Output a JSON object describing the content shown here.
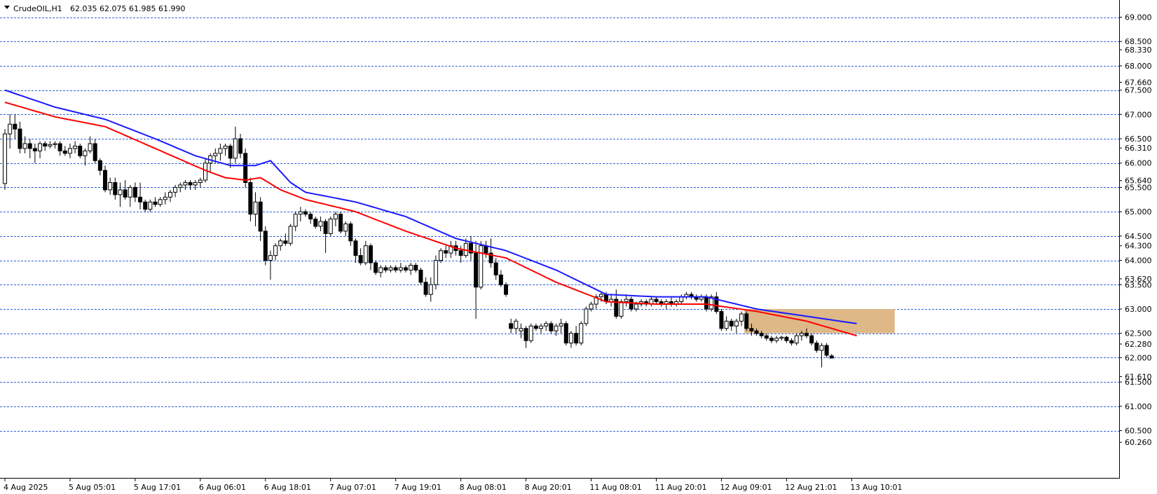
{
  "header": {
    "symbol_label": "CrudeOIL,H1",
    "ohlc_label": "62.035 62.075 61.985 61.990"
  },
  "colors": {
    "background": "#ffffff",
    "grid": "#2d5fd6",
    "candle": "#000000",
    "ma_slow": "#1a1aff",
    "ma_fast": "#ff0000",
    "zone": "#deb887"
  },
  "chart_data": {
    "type": "candlestick",
    "symbol": "CrudeOIL",
    "timeframe": "H1",
    "last_ohlc": {
      "open": 62.035,
      "high": 62.075,
      "low": 61.985,
      "close": 61.99
    },
    "ylim": [
      60.0,
      69.3
    ],
    "grid": true,
    "grid_levels": [
      69.0,
      68.5,
      68.0,
      67.5,
      67.0,
      66.5,
      66.0,
      65.5,
      65.0,
      64.5,
      64.0,
      63.5,
      63.0,
      62.5,
      62.0,
      61.5,
      61.0,
      60.5
    ],
    "y_tick_labels": [
      "69.000",
      "68.500",
      "68.330",
      "68.000",
      "67.660",
      "67.500",
      "67.000",
      "66.500",
      "66.310",
      "66.000",
      "65.640",
      "65.500",
      "65.000",
      "64.500",
      "64.300",
      "64.000",
      "63.620",
      "63.500",
      "63.000",
      "62.500",
      "62.280",
      "62.000",
      "61.610",
      "61.500",
      "61.000",
      "60.500",
      "60.260"
    ],
    "y_tick_values": [
      69.0,
      68.5,
      68.33,
      68.0,
      67.66,
      67.5,
      67.0,
      66.5,
      66.31,
      66.0,
      65.64,
      65.5,
      65.0,
      64.5,
      64.3,
      64.0,
      63.62,
      63.5,
      63.0,
      62.5,
      62.28,
      62.0,
      61.61,
      61.5,
      61.0,
      60.5,
      60.26
    ],
    "x_tick_labels": [
      "4 Aug 2025",
      "5 Aug 05:01",
      "5 Aug 17:01",
      "6 Aug 06:01",
      "6 Aug 18:01",
      "7 Aug 07:01",
      "7 Aug 19:01",
      "8 Aug 08:01",
      "8 Aug 20:01",
      "11 Aug 08:01",
      "11 Aug 20:01",
      "12 Aug 09:01",
      "12 Aug 21:01",
      "13 Aug 10:01"
    ],
    "x_tick_bar_index": [
      0,
      13,
      26,
      39,
      52,
      65,
      78,
      91,
      104,
      117,
      130,
      143,
      156,
      169
    ],
    "zone": {
      "start_bar": 148,
      "end_bar": 178,
      "top": 63.0,
      "bottom": 62.5
    },
    "ma_fast_anchors": [
      [
        0,
        67.25
      ],
      [
        10,
        66.95
      ],
      [
        20,
        66.75
      ],
      [
        30,
        66.3
      ],
      [
        40,
        65.85
      ],
      [
        44,
        65.7
      ],
      [
        48,
        65.65
      ],
      [
        51,
        65.7
      ],
      [
        55,
        65.45
      ],
      [
        60,
        65.25
      ],
      [
        70,
        65.0
      ],
      [
        80,
        64.6
      ],
      [
        90,
        64.25
      ],
      [
        100,
        64.05
      ],
      [
        110,
        63.55
      ],
      [
        120,
        63.15
      ],
      [
        130,
        63.1
      ],
      [
        140,
        63.1
      ],
      [
        150,
        62.95
      ],
      [
        160,
        62.75
      ],
      [
        170,
        62.45
      ]
    ],
    "ma_slow_anchors": [
      [
        0,
        67.5
      ],
      [
        10,
        67.15
      ],
      [
        20,
        66.9
      ],
      [
        30,
        66.5
      ],
      [
        38,
        66.15
      ],
      [
        45,
        65.95
      ],
      [
        50,
        65.95
      ],
      [
        53,
        66.05
      ],
      [
        57,
        65.6
      ],
      [
        60,
        65.4
      ],
      [
        70,
        65.2
      ],
      [
        80,
        64.9
      ],
      [
        90,
        64.45
      ],
      [
        100,
        64.2
      ],
      [
        110,
        63.8
      ],
      [
        120,
        63.3
      ],
      [
        130,
        63.25
      ],
      [
        140,
        63.25
      ],
      [
        150,
        63.0
      ],
      [
        160,
        62.85
      ],
      [
        170,
        62.7
      ]
    ],
    "ohlc": [
      [
        65.58,
        66.7,
        65.45,
        66.6
      ],
      [
        66.6,
        67.0,
        66.3,
        66.8
      ],
      [
        66.8,
        67.0,
        66.5,
        66.7
      ],
      [
        66.7,
        66.85,
        66.2,
        66.3
      ],
      [
        66.3,
        66.55,
        66.2,
        66.4
      ],
      [
        66.4,
        66.5,
        66.1,
        66.3
      ],
      [
        66.3,
        66.4,
        66.0,
        66.25
      ],
      [
        66.25,
        66.45,
        66.1,
        66.4
      ],
      [
        66.4,
        66.45,
        66.25,
        66.35
      ],
      [
        66.35,
        66.45,
        66.3,
        66.38
      ],
      [
        66.38,
        66.45,
        66.3,
        66.4
      ],
      [
        66.4,
        66.45,
        66.15,
        66.25
      ],
      [
        66.25,
        66.35,
        66.15,
        66.2
      ],
      [
        66.2,
        66.4,
        66.1,
        66.3
      ],
      [
        66.3,
        66.45,
        66.2,
        66.35
      ],
      [
        66.35,
        66.4,
        66.1,
        66.15
      ],
      [
        66.15,
        66.3,
        65.95,
        66.25
      ],
      [
        66.25,
        66.55,
        66.2,
        66.4
      ],
      [
        66.4,
        66.5,
        66.0,
        66.05
      ],
      [
        66.05,
        66.1,
        65.75,
        65.85
      ],
      [
        65.85,
        65.95,
        65.4,
        65.45
      ],
      [
        65.45,
        65.7,
        65.35,
        65.6
      ],
      [
        65.6,
        65.7,
        65.25,
        65.35
      ],
      [
        65.35,
        65.6,
        65.1,
        65.45
      ],
      [
        65.45,
        65.65,
        65.25,
        65.3
      ],
      [
        65.3,
        65.55,
        65.1,
        65.5
      ],
      [
        65.5,
        65.6,
        65.2,
        65.3
      ],
      [
        65.3,
        65.6,
        65.05,
        65.2
      ],
      [
        65.2,
        65.25,
        65.0,
        65.05
      ],
      [
        65.05,
        65.25,
        65.0,
        65.2
      ],
      [
        65.2,
        65.3,
        65.1,
        65.15
      ],
      [
        65.15,
        65.3,
        65.1,
        65.25
      ],
      [
        65.25,
        65.4,
        65.15,
        65.3
      ],
      [
        65.3,
        65.45,
        65.2,
        65.4
      ],
      [
        65.4,
        65.55,
        65.3,
        65.5
      ],
      [
        65.5,
        65.6,
        65.4,
        65.55
      ],
      [
        65.55,
        65.65,
        65.45,
        65.6
      ],
      [
        65.6,
        65.65,
        65.45,
        65.55
      ],
      [
        65.55,
        65.65,
        65.45,
        65.6
      ],
      [
        65.6,
        65.7,
        65.5,
        65.65
      ],
      [
        65.65,
        66.1,
        65.6,
        66.0
      ],
      [
        66.0,
        66.2,
        65.8,
        66.15
      ],
      [
        66.15,
        66.3,
        66.0,
        66.2
      ],
      [
        66.2,
        66.4,
        66.05,
        66.3
      ],
      [
        66.3,
        66.4,
        66.15,
        66.35
      ],
      [
        66.35,
        66.4,
        65.9,
        66.1
      ],
      [
        66.1,
        66.75,
        66.0,
        66.5
      ],
      [
        66.5,
        66.6,
        66.1,
        66.2
      ],
      [
        66.2,
        66.3,
        65.5,
        65.6
      ],
      [
        65.6,
        65.7,
        64.8,
        64.95
      ],
      [
        64.95,
        65.4,
        64.7,
        65.2
      ],
      [
        65.2,
        65.3,
        64.4,
        64.6
      ],
      [
        64.6,
        64.7,
        63.9,
        64.0
      ],
      [
        64.0,
        64.2,
        63.6,
        64.1
      ],
      [
        64.1,
        64.35,
        64.0,
        64.3
      ],
      [
        64.3,
        64.45,
        64.2,
        64.4
      ],
      [
        64.4,
        64.55,
        64.3,
        64.35
      ],
      [
        64.35,
        64.75,
        64.3,
        64.7
      ],
      [
        64.7,
        65.0,
        64.6,
        64.95
      ],
      [
        64.95,
        65.1,
        64.8,
        65.0
      ],
      [
        65.0,
        65.05,
        64.9,
        64.95
      ],
      [
        64.95,
        65.0,
        64.75,
        64.85
      ],
      [
        64.85,
        64.9,
        64.65,
        64.7
      ],
      [
        64.7,
        64.9,
        64.6,
        64.8
      ],
      [
        64.8,
        64.85,
        64.15,
        64.55
      ],
      [
        64.55,
        64.9,
        64.5,
        64.85
      ],
      [
        64.85,
        65.0,
        64.7,
        64.95
      ],
      [
        64.95,
        65.0,
        64.55,
        64.6
      ],
      [
        64.6,
        64.8,
        64.5,
        64.75
      ],
      [
        64.75,
        64.8,
        64.3,
        64.4
      ],
      [
        64.4,
        64.45,
        63.95,
        64.1
      ],
      [
        64.1,
        64.25,
        63.9,
        63.95
      ],
      [
        63.95,
        64.4,
        63.9,
        64.3
      ],
      [
        64.3,
        64.35,
        63.8,
        63.95
      ],
      [
        63.95,
        64.0,
        63.7,
        63.75
      ],
      [
        63.75,
        63.9,
        63.65,
        63.85
      ],
      [
        63.85,
        63.9,
        63.75,
        63.8
      ],
      [
        63.8,
        63.9,
        63.75,
        63.85
      ],
      [
        63.85,
        63.9,
        63.75,
        63.8
      ],
      [
        63.8,
        63.95,
        63.75,
        63.85
      ],
      [
        63.85,
        63.9,
        63.75,
        63.8
      ],
      [
        63.8,
        63.95,
        63.7,
        63.9
      ],
      [
        63.9,
        63.95,
        63.75,
        63.8
      ],
      [
        63.8,
        63.85,
        63.5,
        63.55
      ],
      [
        63.55,
        63.65,
        63.25,
        63.3
      ],
      [
        63.3,
        63.65,
        63.15,
        63.5
      ],
      [
        63.5,
        64.1,
        63.4,
        64.0
      ],
      [
        64.0,
        64.25,
        63.95,
        64.2
      ],
      [
        64.2,
        64.3,
        64.05,
        64.15
      ],
      [
        64.15,
        64.4,
        64.05,
        64.3
      ],
      [
        64.3,
        64.4,
        64.1,
        64.2
      ],
      [
        64.2,
        64.3,
        63.95,
        64.1
      ],
      [
        64.1,
        64.45,
        64.05,
        64.35
      ],
      [
        64.35,
        64.5,
        64.0,
        64.15
      ],
      [
        64.15,
        64.4,
        62.8,
        63.45
      ],
      [
        63.45,
        64.4,
        63.4,
        64.3
      ],
      [
        64.3,
        64.4,
        64.05,
        64.15
      ],
      [
        64.15,
        64.45,
        63.85,
        63.95
      ],
      [
        63.95,
        64.05,
        63.6,
        63.7
      ],
      [
        63.7,
        63.8,
        63.45,
        63.5
      ],
      [
        63.5,
        63.55,
        63.25,
        63.3
      ],
      [
        62.7,
        62.8,
        62.5,
        62.6
      ],
      [
        62.6,
        62.8,
        62.5,
        62.75
      ],
      [
        62.55,
        62.7,
        62.4,
        62.6
      ],
      [
        62.6,
        62.65,
        62.2,
        62.35
      ],
      [
        62.35,
        62.7,
        62.3,
        62.65
      ],
      [
        62.65,
        62.7,
        62.55,
        62.6
      ],
      [
        62.6,
        62.7,
        62.5,
        62.65
      ],
      [
        62.65,
        62.75,
        62.55,
        62.7
      ],
      [
        62.7,
        62.75,
        62.5,
        62.55
      ],
      [
        62.55,
        62.7,
        62.45,
        62.65
      ],
      [
        62.65,
        62.8,
        62.5,
        62.7
      ],
      [
        62.7,
        62.75,
        62.25,
        62.3
      ],
      [
        62.3,
        62.55,
        62.2,
        62.5
      ],
      [
        62.5,
        62.65,
        62.25,
        62.3
      ],
      [
        62.3,
        62.75,
        62.25,
        62.7
      ],
      [
        62.7,
        63.05,
        62.65,
        63.0
      ],
      [
        63.0,
        63.15,
        62.95,
        63.1
      ],
      [
        63.1,
        63.3,
        63.0,
        63.25
      ],
      [
        63.25,
        63.35,
        63.15,
        63.3
      ],
      [
        63.3,
        63.35,
        63.1,
        63.15
      ],
      [
        63.15,
        63.3,
        63.05,
        63.2
      ],
      [
        63.2,
        63.4,
        62.8,
        62.85
      ],
      [
        62.85,
        63.2,
        62.8,
        63.15
      ],
      [
        63.15,
        63.3,
        63.05,
        63.2
      ],
      [
        63.2,
        63.25,
        62.95,
        63.0
      ],
      [
        63.0,
        63.15,
        62.95,
        63.1
      ],
      [
        63.1,
        63.2,
        63.05,
        63.15
      ],
      [
        63.15,
        63.2,
        63.05,
        63.1
      ],
      [
        63.1,
        63.25,
        63.05,
        63.2
      ],
      [
        63.2,
        63.25,
        63.1,
        63.15
      ],
      [
        63.15,
        63.2,
        63.05,
        63.1
      ],
      [
        63.1,
        63.2,
        63.0,
        63.15
      ],
      [
        63.15,
        63.25,
        63.05,
        63.1
      ],
      [
        63.1,
        63.2,
        63.05,
        63.15
      ],
      [
        63.15,
        63.3,
        63.1,
        63.25
      ],
      [
        63.25,
        63.35,
        63.2,
        63.3
      ],
      [
        63.3,
        63.35,
        63.2,
        63.25
      ],
      [
        63.25,
        63.3,
        63.15,
        63.2
      ],
      [
        63.2,
        63.3,
        63.15,
        63.25
      ],
      [
        63.25,
        63.3,
        62.95,
        63.0
      ],
      [
        63.0,
        63.3,
        62.95,
        63.25
      ],
      [
        63.25,
        63.35,
        62.9,
        62.95
      ],
      [
        62.95,
        63.0,
        62.55,
        62.6
      ],
      [
        62.6,
        62.85,
        62.55,
        62.75
      ],
      [
        62.75,
        62.8,
        62.55,
        62.65
      ],
      [
        62.65,
        62.8,
        62.5,
        62.75
      ],
      [
        62.75,
        62.95,
        62.65,
        62.9
      ],
      [
        62.9,
        62.95,
        62.55,
        62.6
      ],
      [
        62.6,
        62.7,
        62.45,
        62.55
      ],
      [
        62.55,
        62.6,
        62.45,
        62.5
      ],
      [
        62.5,
        62.55,
        62.4,
        62.45
      ],
      [
        62.45,
        62.5,
        62.35,
        62.4
      ],
      [
        62.4,
        62.45,
        62.3,
        62.35
      ],
      [
        62.35,
        62.45,
        62.3,
        62.4
      ],
      [
        62.4,
        62.45,
        62.35,
        62.42
      ],
      [
        62.42,
        62.45,
        62.3,
        62.35
      ],
      [
        62.35,
        62.4,
        62.25,
        62.3
      ],
      [
        62.3,
        62.5,
        62.25,
        62.45
      ],
      [
        62.45,
        62.55,
        62.35,
        62.5
      ],
      [
        62.5,
        62.6,
        62.4,
        62.45
      ],
      [
        62.45,
        62.5,
        62.25,
        62.3
      ],
      [
        62.3,
        62.35,
        62.1,
        62.15
      ],
      [
        62.15,
        62.3,
        61.8,
        62.25
      ],
      [
        62.25,
        62.3,
        62.0,
        62.05
      ],
      [
        62.035,
        62.075,
        61.985,
        61.99
      ]
    ]
  }
}
